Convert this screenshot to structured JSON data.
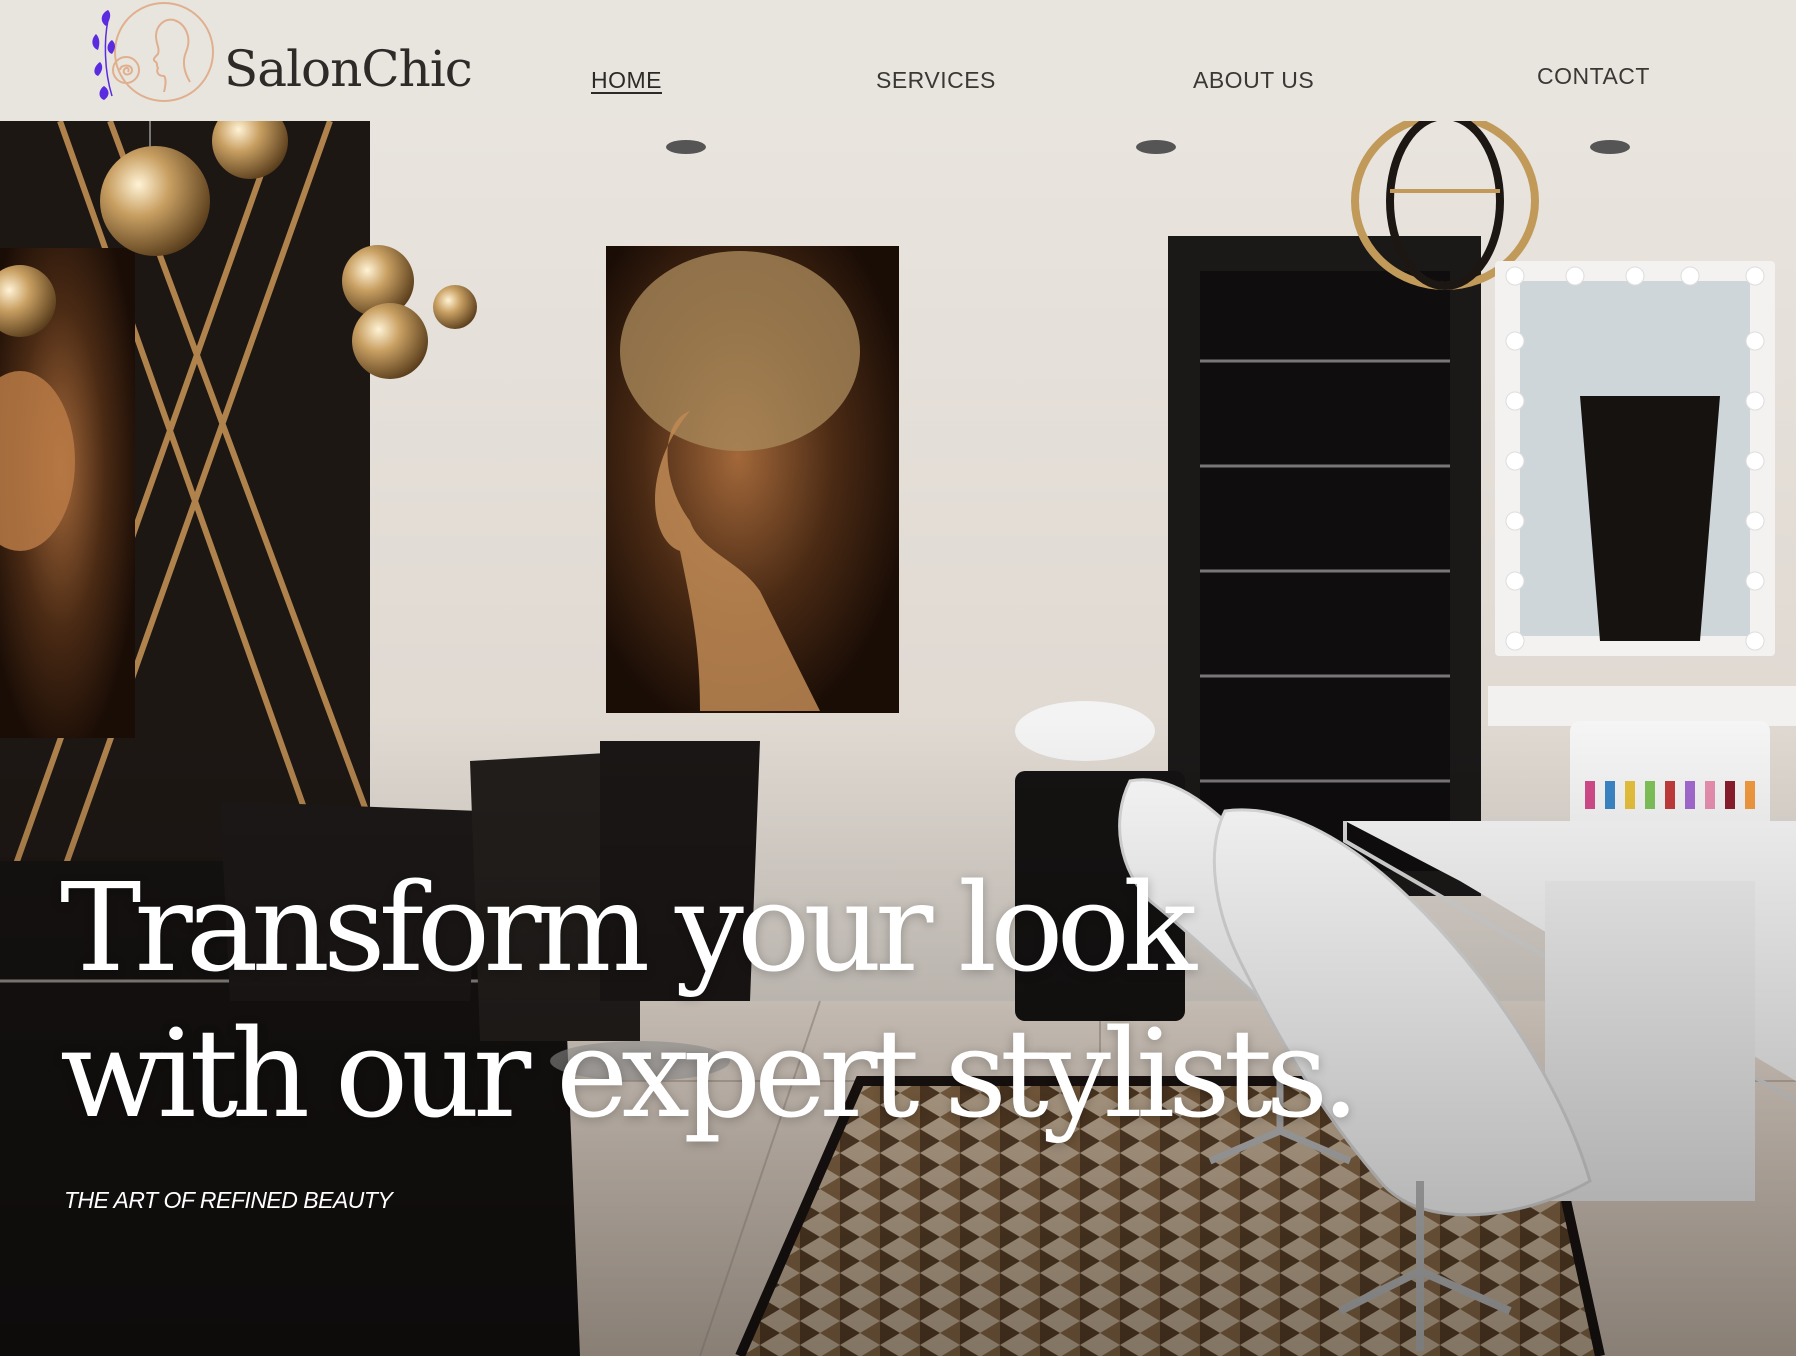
{
  "brand": {
    "name": "SalonChic",
    "logo_icon": "woman-profile-rose-logo-icon"
  },
  "nav": {
    "home": "HOME",
    "services": "SERVICES",
    "about": "ABOUT US",
    "contact": "CONTACT",
    "active": "home"
  },
  "hero": {
    "headline_line1": "Transform your look",
    "headline_line2": "with our expert stylists.",
    "tagline": "THE ART OF REFINED BEAUTY"
  },
  "colors": {
    "header_bg": "#e8e5df",
    "logo_accent": "#5b2be0",
    "logo_line": "#e0b08e",
    "text_dark": "#2e2a27",
    "hero_text": "#ffffff"
  }
}
